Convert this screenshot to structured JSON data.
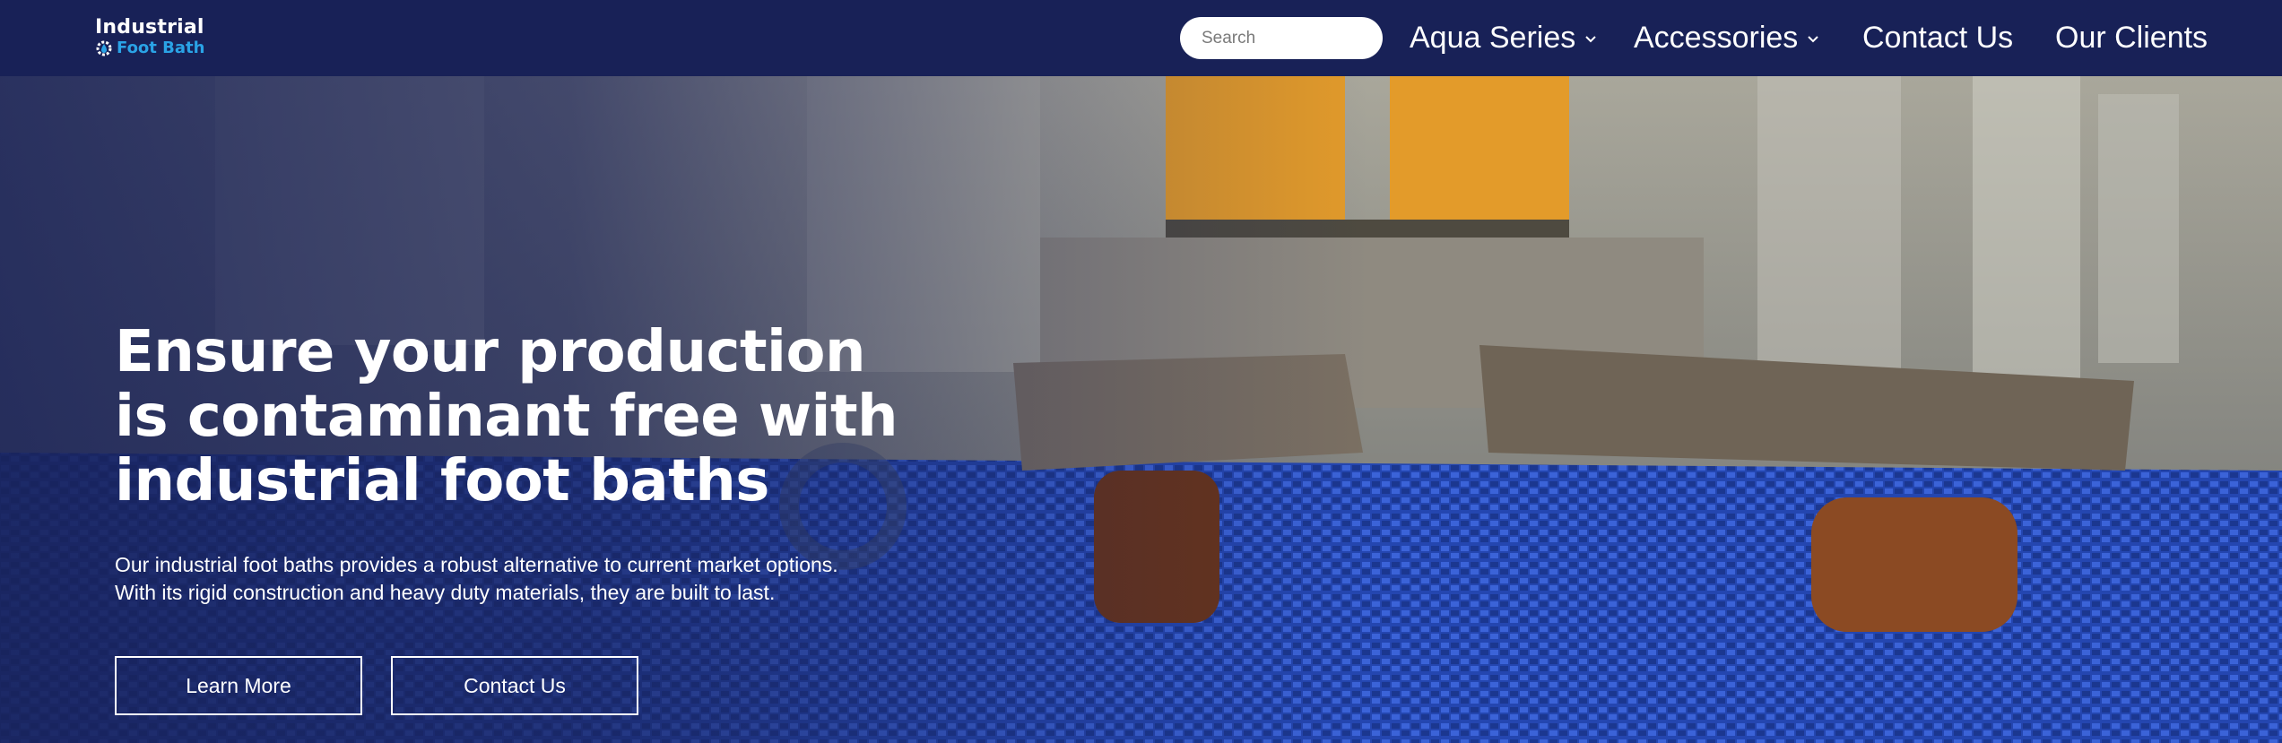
{
  "logo": {
    "line1": "Industrial",
    "line2": "Foot Bath",
    "icon": "gear-drop-icon",
    "accent": "#2aa3e6"
  },
  "search": {
    "placeholder": "Search",
    "value": ""
  },
  "nav": {
    "aqua_series": "Aqua Series",
    "accessories": "Accessories",
    "contact_us": "Contact Us",
    "our_clients": "Our Clients"
  },
  "hero": {
    "title": "Ensure your production is contaminant free with industrial foot baths",
    "subtitle_line1": "Our industrial foot baths provides a robust alternative to current market options.",
    "subtitle_line2": "With its rigid construction and heavy duty materials, they are built to last.",
    "learn_more": "Learn More",
    "contact_us": "Contact Us"
  },
  "colors": {
    "header_bg": "#182157",
    "text": "#ffffff",
    "mat_blue": "#2b4bb7"
  }
}
